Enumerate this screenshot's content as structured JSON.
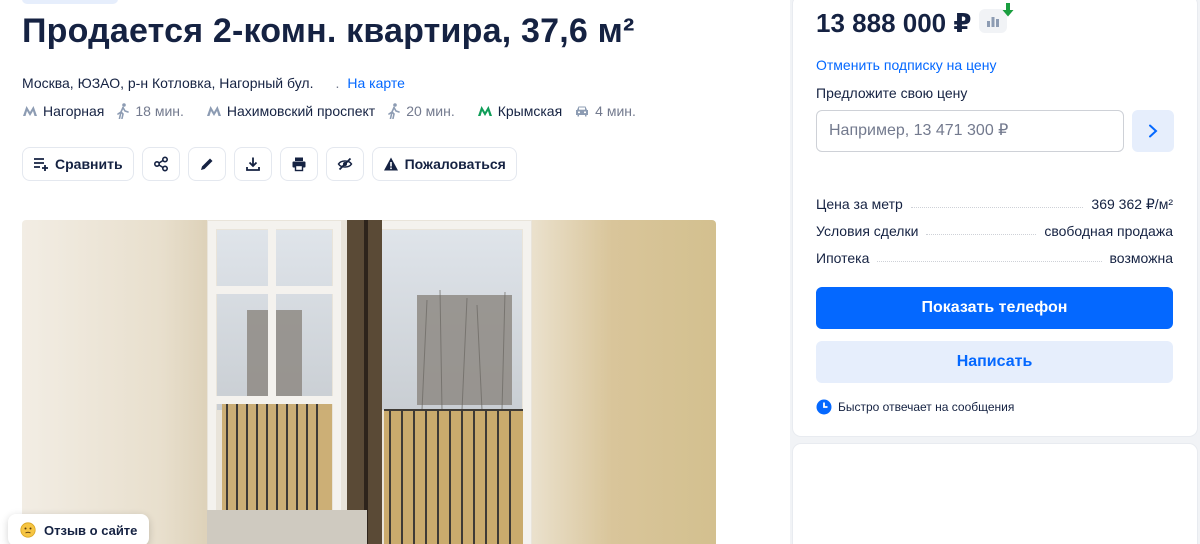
{
  "listing": {
    "title": "Продается 2-комн. квартира, 37,6 м²",
    "address": "Москва, ЮЗАО, р-н Котловка, Нагорный бул.",
    "address_separator": ".",
    "map_link": "На карте",
    "metro": [
      {
        "name": "Нагорная",
        "time": "18 мин.",
        "mode": "walk",
        "line_color": "#8d9cb3"
      },
      {
        "name": "Нахимовский проспект",
        "time": "20 мин.",
        "mode": "walk",
        "line_color": "#8d9cb3"
      },
      {
        "name": "Крымская",
        "time": "4 мин.",
        "mode": "car",
        "line_color": "#0f9d58"
      }
    ]
  },
  "actions": {
    "compare_label": "Сравнить",
    "complain_label": "Пожаловаться",
    "icons": [
      "compare-icon",
      "share-icon",
      "edit-icon",
      "download-icon",
      "print-icon",
      "hide-icon",
      "warning-icon"
    ]
  },
  "review_badge": {
    "label": "Отзыв о сайте"
  },
  "sidebar": {
    "price": "13 888 000 ₽",
    "unsubscribe": "Отменить подписку на цену",
    "offer_label": "Предложите свою цену",
    "offer_placeholder": "Например, 13 471 300 ₽",
    "params": [
      {
        "key": "Цена за метр",
        "value": "369 362 ₽/м²"
      },
      {
        "key": "Условия сделки",
        "value": "свободная продажа"
      },
      {
        "key": "Ипотека",
        "value": "возможна"
      }
    ],
    "phone_button": "Показать телефон",
    "write_button": "Написать",
    "fast_reply": "Быстро отвечает на сообщения"
  },
  "colors": {
    "accent": "#0468ff",
    "accent_light": "#e6eefc",
    "text": "#152242",
    "muted": "#737a8e",
    "price_drop": "#1a9e3f"
  }
}
